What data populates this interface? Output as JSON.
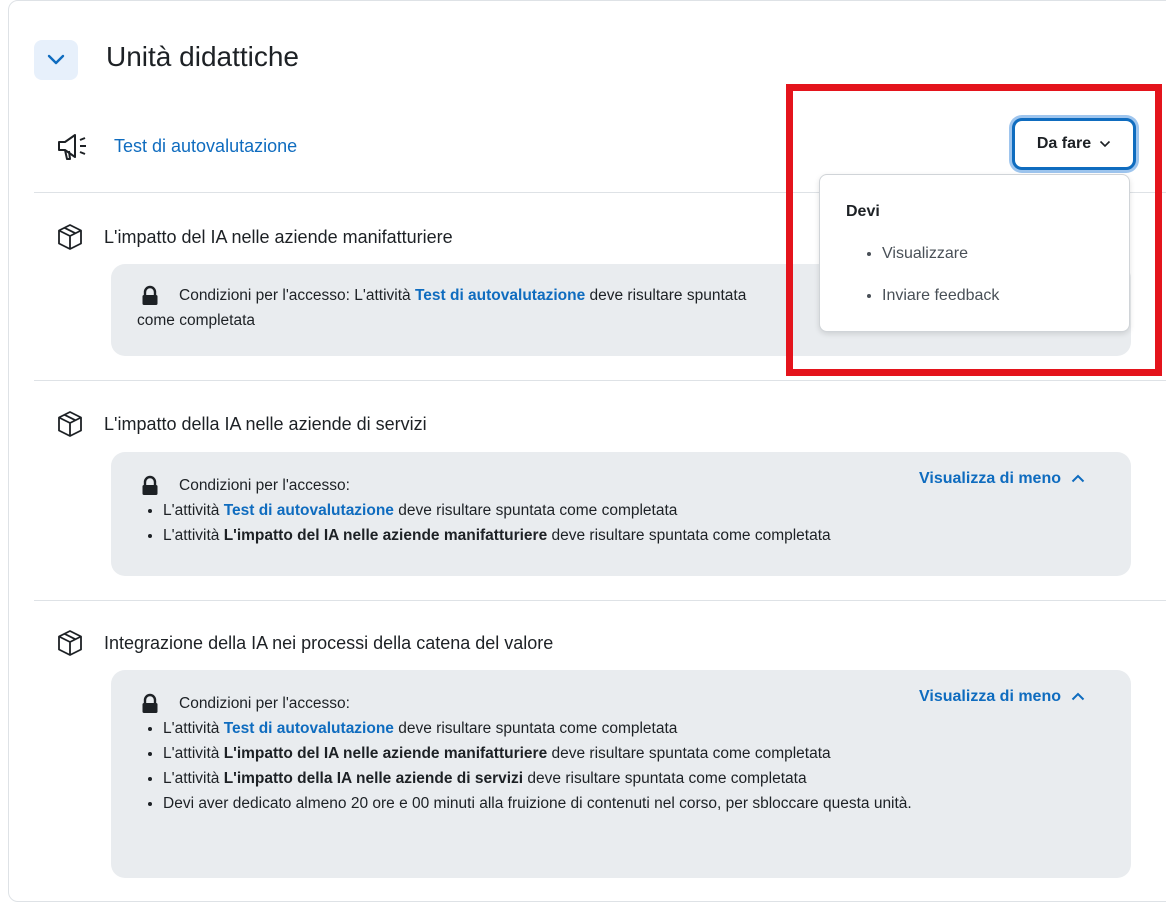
{
  "section": {
    "title": "Unità didattiche"
  },
  "first_activity": {
    "label": "Test di autovalutazione"
  },
  "completion_dropdown": {
    "button_label": "Da fare",
    "heading": "Devi",
    "items": [
      "Visualizzare",
      "Inviare feedback"
    ]
  },
  "activities": [
    {
      "name": "L'impatto del IA nelle aziende manifatturiere",
      "restriction": {
        "prefix": "Condizioni per l'accesso: L'attività ",
        "link": "Test di autovalutazione",
        "suffix": " deve risultare spuntata",
        "line2": "come completata"
      }
    },
    {
      "name": "L'impatto della IA nelle aziende di servizi",
      "restriction": {
        "heading": "Condizioni per l'accesso:",
        "show_less": "Visualizza di meno",
        "items": [
          {
            "pre": "L'attività ",
            "bold": "Test di autovalutazione",
            "post": " deve risultare spuntata come completata",
            "link": true
          },
          {
            "pre": "L'attività ",
            "bold": "L'impatto del IA nelle aziende manifatturiere",
            "post": " deve risultare spuntata come completata",
            "link": false
          }
        ]
      }
    },
    {
      "name": "Integrazione della IA nei processi della catena del valore",
      "restriction": {
        "heading": "Condizioni per l'accesso:",
        "show_less": "Visualizza di meno",
        "items": [
          {
            "pre": "L'attività ",
            "bold": "Test di autovalutazione",
            "post": " deve risultare spuntata come completata",
            "link": true
          },
          {
            "pre": "L'attività ",
            "bold": "L'impatto del IA nelle aziende manifatturiere",
            "post": " deve risultare spuntata come completata",
            "link": false
          },
          {
            "pre": "L'attività ",
            "bold": "L'impatto della IA nelle aziende di servizi",
            "post": " deve risultare spuntata come completata",
            "link": false
          },
          {
            "pre": "Devi aver dedicato almeno 20 ore e 00 minuti alla fruizione di contenuti nel corso, per sbloccare questa unità.",
            "bold": "",
            "post": "",
            "link": false
          }
        ]
      }
    }
  ],
  "colors": {
    "link": "#0f6cbf",
    "highlight": "#e4141c",
    "restriction_bg": "#e9ecef"
  }
}
